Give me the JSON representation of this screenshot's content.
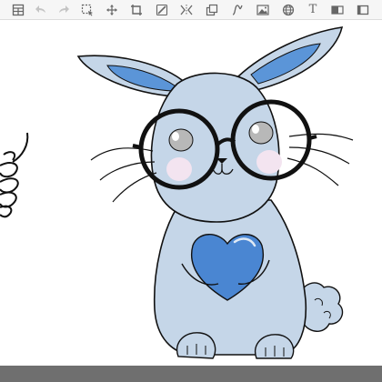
{
  "toolbar": {
    "tools": [
      {
        "icon": "layers-icon",
        "enabled": true
      },
      {
        "icon": "undo-icon",
        "enabled": false
      },
      {
        "icon": "redo-icon",
        "enabled": false
      },
      {
        "icon": "selection-icon",
        "enabled": true
      },
      {
        "icon": "transform-icon",
        "enabled": true
      },
      {
        "icon": "crop-icon",
        "enabled": true
      },
      {
        "icon": "pen-icon",
        "enabled": true
      },
      {
        "icon": "symmetry-icon",
        "enabled": true
      },
      {
        "icon": "clone-icon",
        "enabled": true
      },
      {
        "icon": "curve-icon",
        "enabled": true
      },
      {
        "icon": "image-icon",
        "enabled": true
      },
      {
        "icon": "globe-icon",
        "enabled": true
      },
      {
        "icon": "text-icon",
        "enabled": true,
        "glyph": "T"
      },
      {
        "icon": "fill-icon",
        "enabled": true
      },
      {
        "icon": "fullscreen-icon",
        "enabled": true
      }
    ]
  },
  "colors": {
    "toolbar_bg": "#f6f6f6",
    "icon": "#666666",
    "icon_disabled": "#c4c4c4",
    "canvas_bg": "#ffffff",
    "rabbit_body": "#c5d6e8",
    "ear_inner": "#5b95d8",
    "heart": "#4a86d2",
    "cheek": "#f3e4f0",
    "eye": "#b8b8b8",
    "outline": "#111111",
    "frame": "#d3d3d3",
    "bottom_bar": "#6f6f6f"
  }
}
